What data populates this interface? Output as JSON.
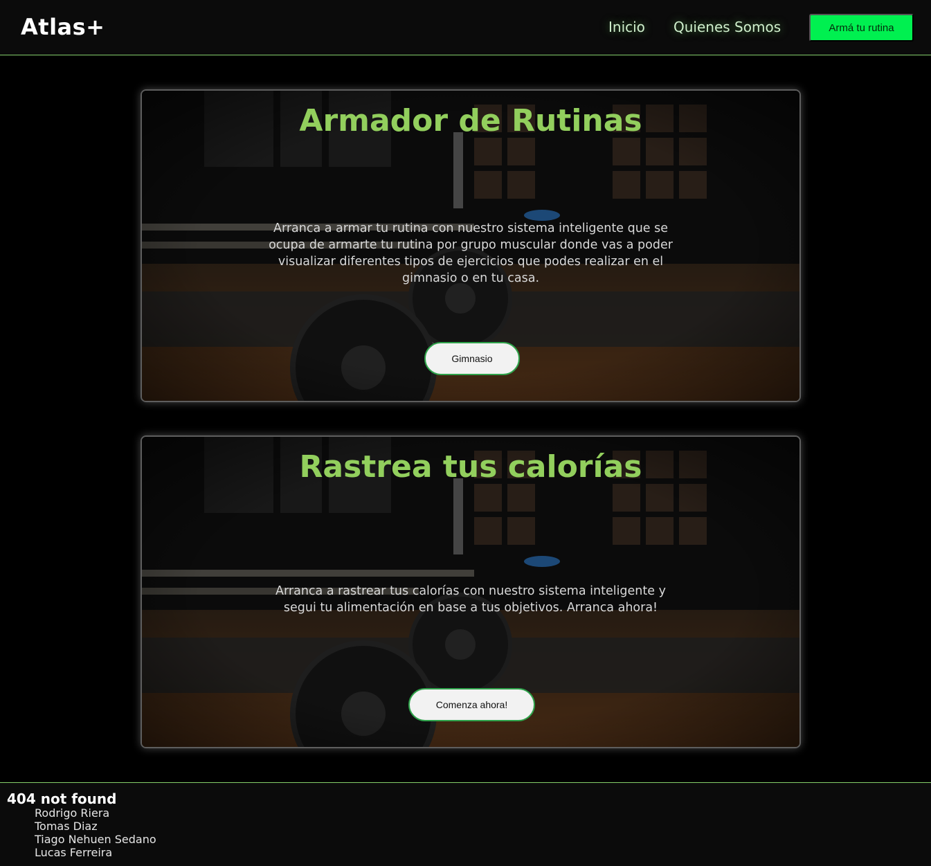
{
  "header": {
    "brand": "Atlas+",
    "nav": {
      "inicio": "Inicio",
      "quienes": "Quienes Somos"
    },
    "cta": "Armá tu rutina"
  },
  "cards": [
    {
      "title": "Armador de Rutinas",
      "description": "Arranca a armar tu rutina con nuestro sistema inteligente que se ocupa de armarte tu rutina por grupo muscular donde vas a poder visualizar diferentes tipos de ejercicios que podes realizar en el gimnasio o en tu casa.",
      "button": "Gimnasio"
    },
    {
      "title": "Rastrea tus calorías",
      "description": "Arranca a rastrear tus calorías con nuestro sistema inteligente y segui tu alimentación en base a tus objetivos. Arranca ahora!",
      "button": "Comenza ahora!"
    }
  ],
  "footer": {
    "title": "404 not found",
    "members": [
      "Rodrigo Riera",
      "Tomas Diaz",
      "Tiago Nehuen Sedano",
      "Lucas Ferreira"
    ]
  },
  "colors": {
    "accent": "#00f050",
    "title_green": "#92cf5d",
    "border_green": "#86d06b"
  }
}
